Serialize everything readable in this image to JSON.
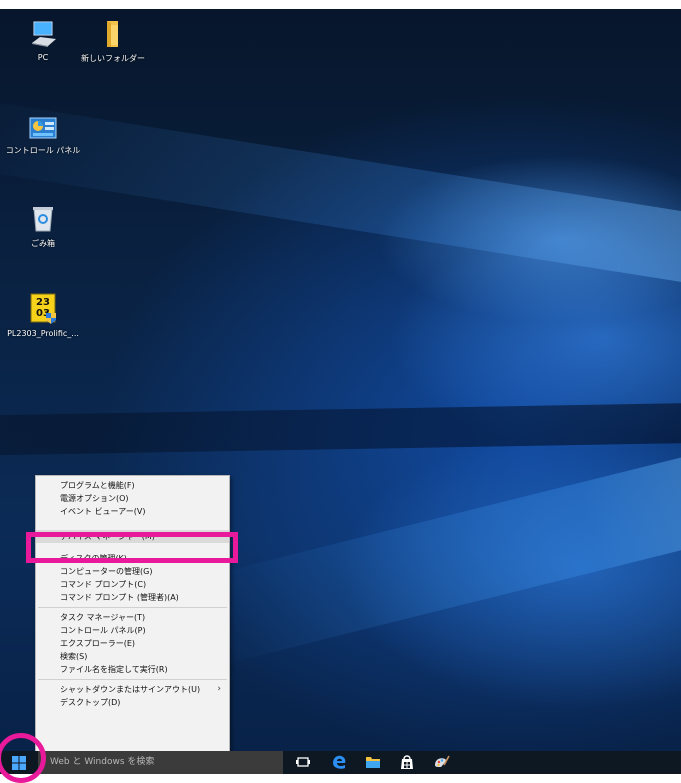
{
  "desktop": {
    "icons": [
      {
        "label": "PC",
        "icon": "pc-icon"
      },
      {
        "label": "新しいフォルダー",
        "icon": "folder-icon"
      },
      {
        "label": "コントロール パネル",
        "icon": "control-panel-icon"
      },
      {
        "label": "ごみ箱",
        "icon": "recycle-bin-icon"
      },
      {
        "label": "PL2303_Prolific_...",
        "icon": "calendar-installer-icon"
      }
    ],
    "pl2303_icon_text": [
      "23",
      "03"
    ]
  },
  "context_menu": {
    "items": [
      {
        "label": "プログラムと機能(F)"
      },
      {
        "label": "電源オプション(O)"
      },
      {
        "label": "イベント ビューアー(V)"
      },
      {
        "label": "デバイス マネージャー(M)",
        "highlighted": true
      },
      {
        "label": "ディスクの管理(K)"
      },
      {
        "label": "コンピューターの管理(G)"
      },
      {
        "label": "コマンド プロンプト(C)"
      },
      {
        "label": "コマンド プロンプト (管理者)(A)"
      },
      {
        "label": "タスク マネージャー(T)"
      },
      {
        "label": "コントロール パネル(P)"
      },
      {
        "label": "エクスプローラー(E)"
      },
      {
        "label": "検索(S)"
      },
      {
        "label": "ファイル名を指定して実行(R)"
      },
      {
        "label": "シャットダウンまたはサインアウト(U)",
        "submenu_glyph": "›"
      },
      {
        "label": "デスクトップ(D)"
      }
    ]
  },
  "taskbar": {
    "search_placeholder": "Web と Windows を検索",
    "icons": [
      "task-view-icon",
      "edge-icon",
      "file-explorer-icon",
      "store-icon",
      "paint-icon"
    ]
  },
  "colors": {
    "annotation": "#e8199a",
    "taskbar": "#0e1822",
    "menu_bg": "#f2f2f2"
  }
}
